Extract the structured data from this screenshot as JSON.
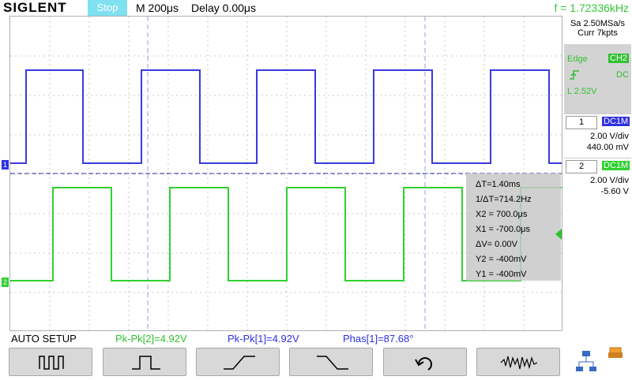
{
  "header": {
    "logo": "SIGLENT",
    "run_state": "Stop",
    "timebase": "M 200μs",
    "delay": "Delay 0.00μs",
    "frequency": "f = 1.72336kHz"
  },
  "acquisition": {
    "sample_rate": "Sa 2.50MSa/s",
    "memory": "Curr 7kpts"
  },
  "trigger": {
    "type": "Edge",
    "source": "CH2",
    "slope_icon": "rising-edge-icon",
    "coupling": "DC",
    "level": "L  2.52V"
  },
  "channels": [
    {
      "number": "1",
      "coupling": "DC1M",
      "scale": "2.00 V/div",
      "offset": "440.00 mV",
      "color": "#3030e0"
    },
    {
      "number": "2",
      "coupling": "DC1M",
      "scale": "2.00 V/div",
      "offset": "-5.60 V",
      "color": "#30d030"
    }
  ],
  "cursors": {
    "delta_t": "ΔT=1.40ms",
    "inv_delta_t": "1/ΔT=714.2Hz",
    "x2": "X2 = 700.0μs",
    "x1": "X1 = -700.0μs",
    "delta_v": "ΔV= 0.00V",
    "y2": "Y2 = -400mV",
    "y1": "Y1 = -400mV"
  },
  "measurements": {
    "auto_setup": "AUTO SETUP",
    "m1": "Pk-Pk[2]=4.92V",
    "m2": "Pk-Pk[1]=4.92V",
    "m3": "Phas[1]=87.68°"
  },
  "softkeys": [
    {
      "name": "pulse-train-icon"
    },
    {
      "name": "single-pulse-icon"
    },
    {
      "name": "rising-edge-icon"
    },
    {
      "name": "falling-edge-icon"
    },
    {
      "name": "undo-icon"
    },
    {
      "name": "noise-wave-icon"
    }
  ],
  "colors": {
    "ch1": "#3030e0",
    "ch2": "#30d030",
    "trigger": "#f08a1e",
    "accent": "#7fe0f0"
  }
}
